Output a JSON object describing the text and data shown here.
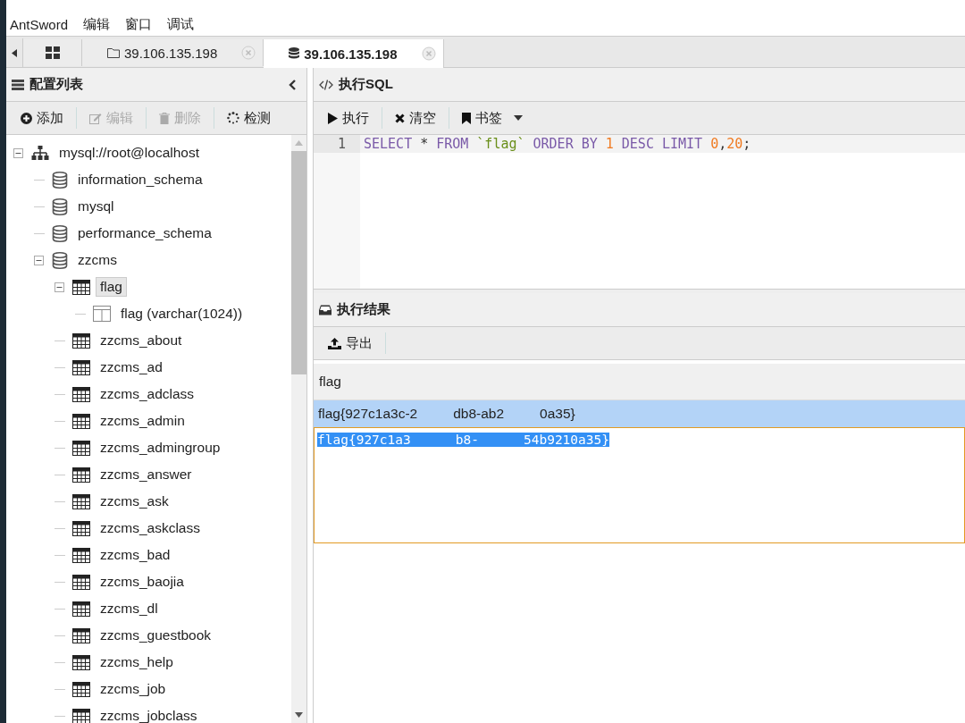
{
  "menu": [
    "AntSword",
    "编辑",
    "窗口",
    "调试"
  ],
  "tabs": [
    {
      "kind": "home",
      "selected": false
    },
    {
      "kind": "folder",
      "label": "39.106.135.198",
      "selected": false
    },
    {
      "kind": "database",
      "label": "39.106.135.198",
      "selected": true
    }
  ],
  "left_panel": {
    "title": "配置列表",
    "toolbar": [
      {
        "kind": "add",
        "label": "添加",
        "disabled": false
      },
      {
        "kind": "edit",
        "label": "编辑",
        "disabled": true
      },
      {
        "kind": "delete",
        "label": "删除",
        "disabled": true
      },
      {
        "kind": "check",
        "label": "检测",
        "disabled": false
      }
    ],
    "tree": {
      "label": "mysql://root@localhost",
      "kind": "server",
      "expanded": true,
      "children": [
        {
          "label": "information_schema",
          "kind": "database"
        },
        {
          "label": "mysql",
          "kind": "database"
        },
        {
          "label": "performance_schema",
          "kind": "database"
        },
        {
          "label": "zzcms",
          "kind": "database",
          "expanded": true,
          "children": [
            {
              "label": "flag",
              "kind": "table",
              "expanded": true,
              "selected": true,
              "children": [
                {
                  "label": "flag (varchar(1024))",
                  "kind": "column"
                }
              ]
            },
            {
              "label": "zzcms_about",
              "kind": "table",
              "selected": false
            },
            {
              "label": "zzcms_ad",
              "kind": "table",
              "selected": false
            },
            {
              "label": "zzcms_adclass",
              "kind": "table",
              "selected": false
            },
            {
              "label": "zzcms_admin",
              "kind": "table",
              "selected": false
            },
            {
              "label": "zzcms_admingroup",
              "kind": "table",
              "selected": false
            },
            {
              "label": "zzcms_answer",
              "kind": "table",
              "selected": false
            },
            {
              "label": "zzcms_ask",
              "kind": "table",
              "selected": false
            },
            {
              "label": "zzcms_askclass",
              "kind": "table",
              "selected": false
            },
            {
              "label": "zzcms_bad",
              "kind": "table",
              "selected": false
            },
            {
              "label": "zzcms_baojia",
              "kind": "table",
              "selected": false
            },
            {
              "label": "zzcms_dl",
              "kind": "table",
              "selected": false
            },
            {
              "label": "zzcms_guestbook",
              "kind": "table",
              "selected": false
            },
            {
              "label": "zzcms_help",
              "kind": "table",
              "selected": false
            },
            {
              "label": "zzcms_job",
              "kind": "table",
              "selected": false
            },
            {
              "label": "zzcms_jobclass",
              "kind": "table",
              "selected": false
            }
          ]
        }
      ]
    }
  },
  "sql_panel": {
    "title": "执行SQL",
    "toolbar": [
      {
        "kind": "run",
        "label": "执行"
      },
      {
        "kind": "clear",
        "label": "清空"
      },
      {
        "kind": "bookmark",
        "label": "书签"
      }
    ],
    "line_number": "1",
    "tokens": [
      {
        "kind": "keyword",
        "text": "SELECT",
        "space_before": false
      },
      {
        "kind": "plain",
        "text": "*",
        "space_before": true
      },
      {
        "kind": "keyword",
        "text": "FROM",
        "space_before": true
      },
      {
        "kind": "string",
        "text": "`flag`",
        "space_before": true
      },
      {
        "kind": "keyword",
        "text": "ORDER BY",
        "space_before": true
      },
      {
        "kind": "number",
        "text": "1",
        "space_before": true
      },
      {
        "kind": "keyword",
        "text": "DESC LIMIT",
        "space_before": true
      },
      {
        "kind": "number",
        "text": "0",
        "space_before": true
      },
      {
        "kind": "plain",
        "text": ",",
        "space_before": false
      },
      {
        "kind": "number",
        "text": "20",
        "space_before": false
      },
      {
        "kind": "plain",
        "text": ";",
        "space_before": false
      }
    ]
  },
  "result_panel": {
    "title": "执行结果",
    "toolbar": [
      {
        "kind": "export",
        "label": "导出"
      }
    ],
    "column": "flag",
    "row_parts": [
      "flag{927c1a3c-2",
      "db8-ab2",
      "0a35}"
    ],
    "editor_parts": [
      "flag{927c1a3",
      "b8-",
      "54b9210a35}"
    ]
  }
}
